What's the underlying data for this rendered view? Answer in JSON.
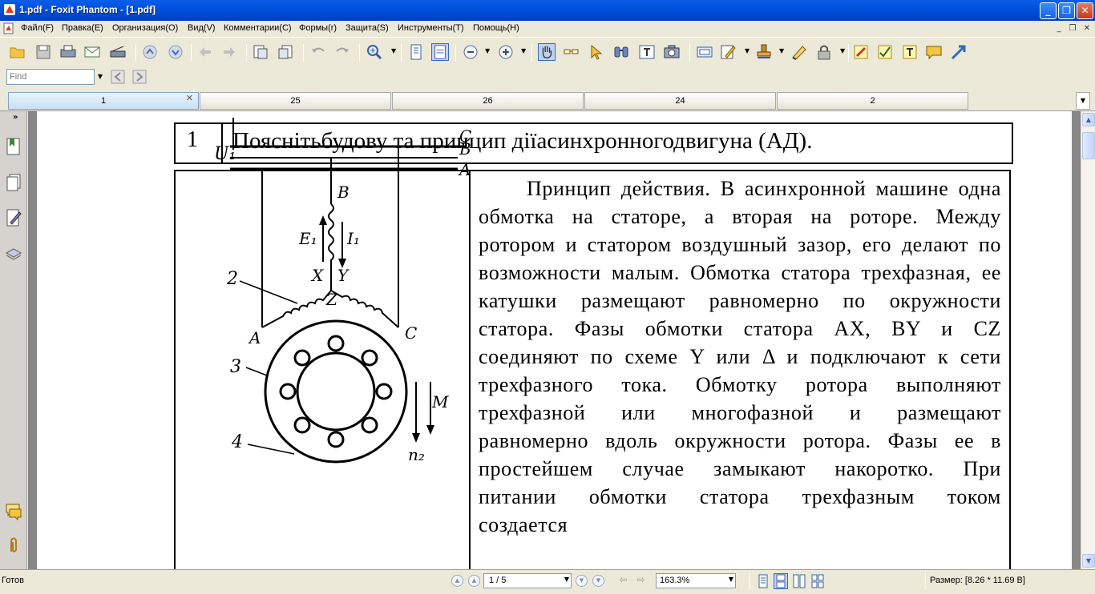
{
  "window": {
    "title": "1.pdf - Foxit Phantom - [1.pdf]",
    "controls": [
      "minimize",
      "maximize",
      "close"
    ],
    "accent": "#0054E3"
  },
  "menu": {
    "items": [
      "Файл(F)",
      "Правка(E)",
      "Организация(O)",
      "Вид(V)",
      "Комментарии(C)",
      "Формы(r)",
      "Защита(S)",
      "Инструменты(T)",
      "Помощь(H)"
    ]
  },
  "toolbar": {
    "buttons": [
      "open-folder-icon",
      "save-icon",
      "print-icon",
      "email-icon",
      "scan-icon",
      "prev-page-icon",
      "next-page-icon",
      "back-icon",
      "forward-icon",
      "zoom-in-icon",
      "fit-page-icon",
      "fit-width-icon",
      "zoom-out-icon",
      "zoom-plus-icon",
      "hand-tool-icon",
      "select-text-icon",
      "select-annotation-icon",
      "find-icon",
      "typewriter-icon",
      "snapshot-icon",
      "form-icon",
      "edit-icon",
      "stamp-icon",
      "sign-icon",
      "lock-icon",
      "highlight-icon",
      "note-icon",
      "textbox-icon",
      "comment-icon",
      "arrow-icon"
    ]
  },
  "find": {
    "placeholder": "Find"
  },
  "tabs": [
    {
      "label": "1",
      "active": true
    },
    {
      "label": "25",
      "active": false
    },
    {
      "label": "26",
      "active": false
    },
    {
      "label": "24",
      "active": false
    },
    {
      "label": "2",
      "active": false
    }
  ],
  "document": {
    "row_number": "1",
    "question": "Пояснітьбудову  та  принцип діїасинхронногодвигуна (АД).",
    "body": "Принцип действия. В асинхронной машине одна обмотка на статоре, а вторая на роторе. Между ротором и статором воздушный зазор, его делают по возможности малым. Обмотка статора трехфазная, ее катушки размещают равномерно по окружности статора. Фазы обмотки статора АХ, BY и CZ соединяют по схеме Y или Δ и подключают к сети трехфазного тока. Обмотку ротора выполняют трехфазной или многофазной и размещают равномерно вдоль окружности ротора. Фазы ее в простейшем случае замыкают накоротко. При питании обмотки статора трехфазным током создается",
    "diagram_labels": {
      "u1": "U₁",
      "phase_a_top": "A",
      "phase_b_top": "B",
      "phase_c_top": "C",
      "b_mid": "B",
      "e1": "E₁",
      "i1": "I₁",
      "x": "X",
      "y": "Y",
      "z": "Z",
      "num2": "2",
      "a_bottom": "A",
      "c_bottom": "C",
      "num3": "3",
      "num4": "4",
      "m": "M",
      "n2": "n₂"
    }
  },
  "status": {
    "text": "Готов",
    "page": "1 / 5",
    "zoom": "163.3%",
    "size": "Размер: [8.26 * 11.69 В]"
  }
}
